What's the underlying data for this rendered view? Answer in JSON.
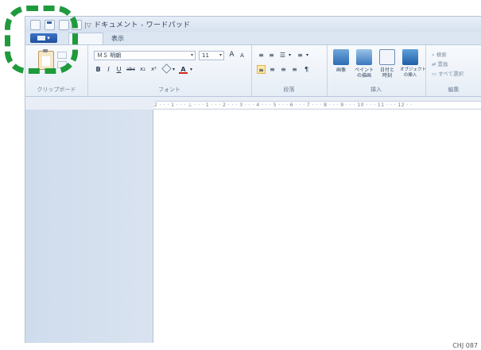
{
  "window": {
    "title": "ドキュメント - ワードパッド",
    "qa_separator": "|▽"
  },
  "tabs": {
    "file_label": "▾",
    "view_label": "表示"
  },
  "ribbon": {
    "clipboard": {
      "group_label": "クリップボード"
    },
    "font": {
      "font_name": "ＭＳ 明朝",
      "font_size": "11",
      "dropdown_arrow": "▾",
      "grow": "A",
      "shrink": "A",
      "bold": "B",
      "italic": "I",
      "underline": "U",
      "strike": "abc",
      "subscript": "x₂",
      "superscript": "x²",
      "highlight_arrow": "▾",
      "color_glyph": "A",
      "color_arrow": "▾",
      "group_label": "フォント"
    },
    "paragraph": {
      "list_arrow": "▾",
      "spacing_arrow": "▾",
      "group_label": "段落"
    },
    "insert": {
      "picture": "画像",
      "paint": "ペイント\nの描画",
      "datetime": "日付と\n時刻",
      "object": "オブジェクト\nの挿入",
      "group_label": "挿入"
    },
    "editing": {
      "find": "検索",
      "replace": "置換",
      "select_all": "すべて選択",
      "group_label": "編集"
    }
  },
  "ruler": {
    "text": "2 · · · 1 · · · ⊥ · · · 1 · · · 2 · · · 3 · · · 4 · · · 5 · · · 6 · · · 7 · · · 8 · · · 9 · · · 10 · · · 11 · · · 12 · ·"
  },
  "footer": {
    "code": "CHJ 087"
  },
  "colors": {
    "highlight": "#1f9a3c",
    "file_button": "#2a5fb0"
  }
}
